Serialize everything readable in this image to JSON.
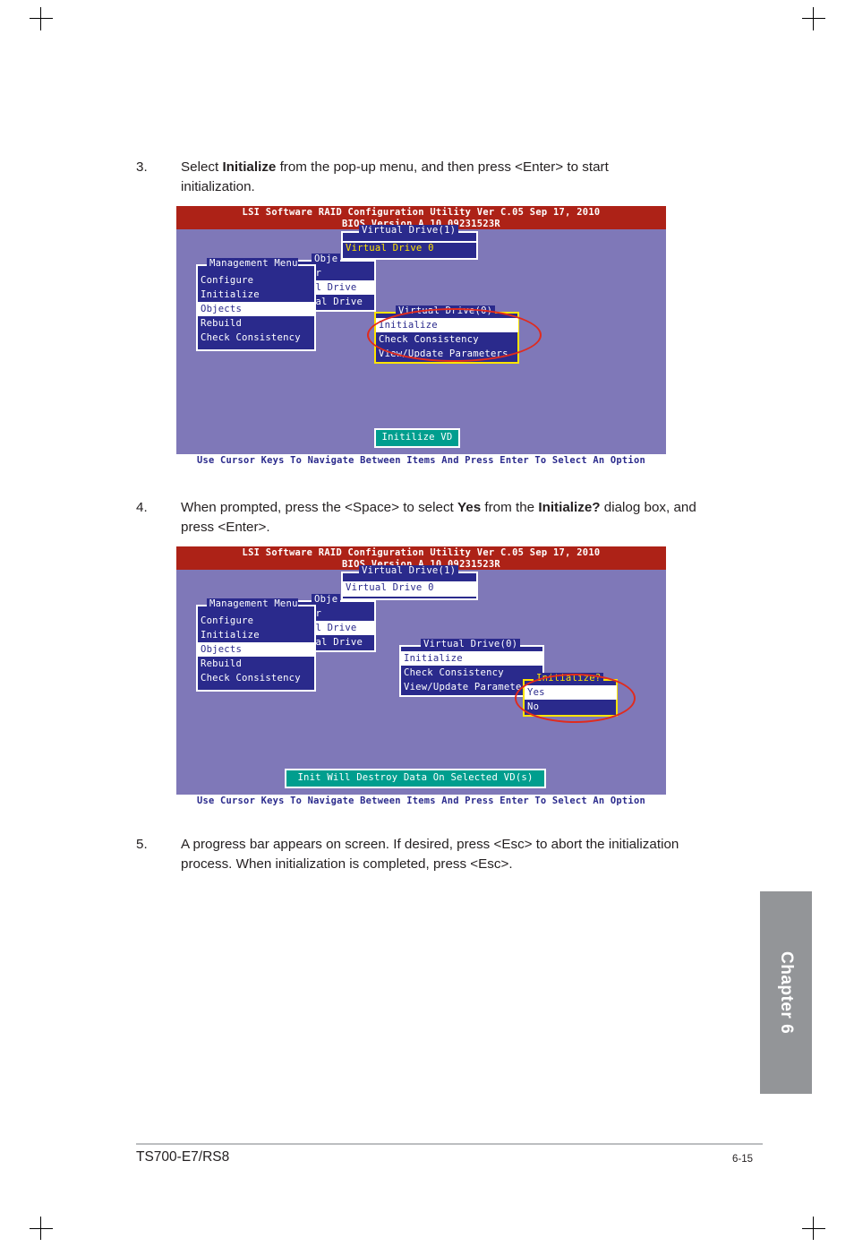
{
  "steps": [
    {
      "num": "3.",
      "parts": [
        {
          "t": "Select ",
          "b": false
        },
        {
          "t": "Initialize",
          "b": true
        },
        {
          "t": " from the pop-up menu, and then press <Enter> to start initialization.",
          "b": false
        }
      ]
    },
    {
      "num": "4.",
      "parts": [
        {
          "t": "When prompted, press the <Space> to select ",
          "b": false
        },
        {
          "t": "Yes",
          "b": true
        },
        {
          "t": " from the ",
          "b": false
        },
        {
          "t": "Initialize?",
          "b": true
        },
        {
          "t": " dialog box, and press <Enter>.",
          "b": false
        }
      ]
    },
    {
      "num": "5.",
      "parts": [
        {
          "t": "A progress bar appears on screen. If desired, press <Esc> to abort the initialization process. When initialization is completed, press <Esc>.",
          "b": false
        }
      ]
    }
  ],
  "bios1": {
    "title_line1": "LSI Software RAID Configuration Utility Ver C.05 Sep 17, 2010",
    "title_line2": "BIOS Version   A.10.09231523R",
    "vd1_panel": {
      "legend": "Virtual Drive(1)",
      "items": [
        "Virtual Drive 0"
      ]
    },
    "objects_panel": {
      "legend": "Obje",
      "items": [
        "Adapter",
        "Virtual Drive",
        "Physical Drive"
      ],
      "selected": "Virtual Drive"
    },
    "management_panel": {
      "legend": "Management Menu",
      "items": [
        "Configure",
        "Initialize",
        "Objects",
        "Rebuild",
        "Check Consistency"
      ],
      "selected": "Objects"
    },
    "vd0_panel": {
      "legend": "Virtual Drive(0)",
      "items": [
        "Initialize",
        "Check Consistency",
        "View/Update Parameters"
      ],
      "selected": "Initialize"
    },
    "status": "Initilize VD",
    "footer": "Use Cursor Keys To Navigate Between Items And Press Enter To Select An Option"
  },
  "bios2": {
    "title_line1": "LSI Software RAID Configuration Utility Ver C.05 Sep 17, 2010",
    "title_line2": "BIOS Version   A.10.09231523R",
    "vd1_panel": {
      "legend": "Virtual Drive(1)",
      "items": [
        "Virtual Drive 0"
      ],
      "selected": "Virtual Drive 0"
    },
    "objects_panel": {
      "legend": "Obje",
      "items": [
        "Adapter",
        "Virtual Drive",
        "Physical Drive"
      ],
      "selected": "Virtual Drive"
    },
    "management_panel": {
      "legend": "Management Menu",
      "items": [
        "Configure",
        "Initialize",
        "Objects",
        "Rebuild",
        "Check Consistency"
      ],
      "selected": "Objects"
    },
    "vd0_panel": {
      "legend": "Virtual Drive(0)",
      "items": [
        "Initialize",
        "Check Consistency",
        "View/Update Parameters"
      ],
      "selected": "Initialize"
    },
    "initialize_dialog": {
      "legend": "Initialize?",
      "items": [
        "Yes",
        "No"
      ],
      "selected": "Yes"
    },
    "status": "Init Will Destroy Data On Selected VD(s)",
    "footer": "Use Cursor Keys To Navigate Between Items And Press Enter To Select An Option"
  },
  "chapter_tab": "Chapter 6",
  "footer": {
    "model": "TS700-E7/RS8",
    "page": "6-15"
  }
}
